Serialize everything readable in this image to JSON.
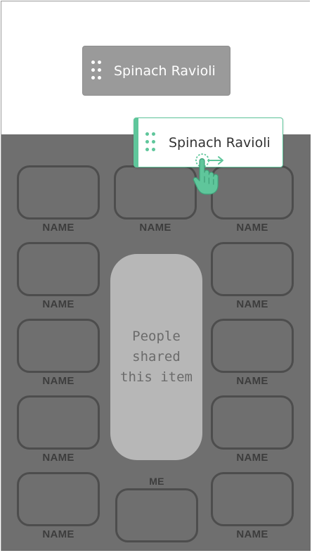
{
  "source_item": {
    "label": "Spinach Ravioli"
  },
  "dragged_item": {
    "label": "Spinach Ravioli"
  },
  "center_panel": {
    "text": "People\nshared\nthis item"
  },
  "seats": [
    {
      "label": "NAME"
    },
    {
      "label": "NAME"
    },
    {
      "label": "NAME"
    },
    {
      "label": "NAME"
    },
    {
      "label": "NAME"
    },
    {
      "label": "NAME"
    },
    {
      "label": "NAME"
    },
    {
      "label": "NAME"
    },
    {
      "label": "NAME"
    },
    {
      "label": "NAME"
    },
    {
      "label": "ME"
    },
    {
      "label": "NAME"
    }
  ],
  "colors": {
    "accent": "#5fc69b",
    "overlay": "#6f6f6f",
    "seat_border": "#4d4d4d"
  },
  "icons": [
    "drag-handle-icon",
    "pointer-hand-icon"
  ]
}
